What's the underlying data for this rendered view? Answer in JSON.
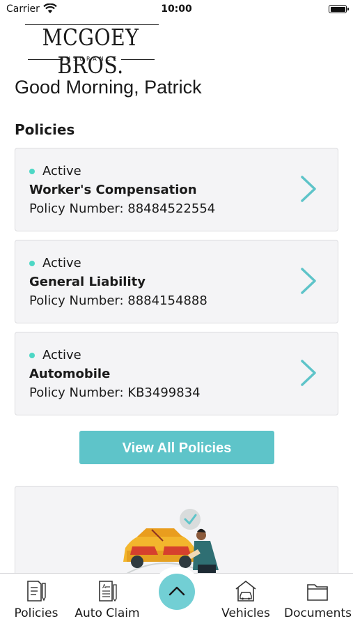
{
  "status_bar": {
    "carrier": "Carrier",
    "time": "10:00"
  },
  "logo": {
    "name": "MCGOEY BROS.",
    "subtitle": "INSURANCE"
  },
  "greeting": "Good Morning, Patrick",
  "policies_section": {
    "title": "Policies",
    "items": [
      {
        "status": "Active",
        "name": "Worker's Compensation",
        "number": "Policy Number: 88484522554"
      },
      {
        "status": "Active",
        "name": "General Liability",
        "number": "Policy Number: 8884154888"
      },
      {
        "status": "Active",
        "name": "Automobile",
        "number": "Policy Number: KB3499834"
      }
    ],
    "view_all_label": "View All Policies"
  },
  "tab_bar": {
    "items": [
      {
        "label": "Policies",
        "icon": "policies-document-icon"
      },
      {
        "label": "Auto Claim",
        "icon": "auto-claim-form-icon"
      },
      {
        "label": "Vehicles",
        "icon": "vehicle-garage-icon"
      },
      {
        "label": "Documents",
        "icon": "folder-icon"
      }
    ],
    "fab_icon": "chevron-up-icon"
  },
  "colors": {
    "accent": "#5ec4c9",
    "status_active": "#4dd7c5",
    "card_bg": "#f4f4f6"
  }
}
